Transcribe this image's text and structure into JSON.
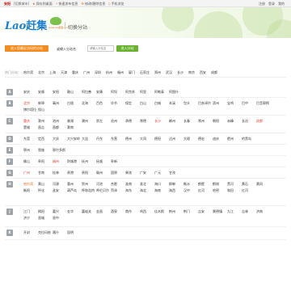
{
  "topbar": {
    "city": "安阳",
    "switch": "[切换城市]",
    "links": [
      {
        "icon": "star-icon",
        "label": "保存到桌面"
      },
      {
        "icon": "lightning-icon",
        "label": "快速发布信息"
      },
      {
        "icon": "gear-icon",
        "label": "修改/删除信息"
      },
      {
        "icon": "phone-icon",
        "label": "手机浏览"
      }
    ],
    "right": [
      "注册",
      "登录",
      "我的"
    ]
  },
  "header": {
    "logo_text": "Lao",
    "logo_cn": "赶集",
    "logo_sub": "www.lao赶集.com",
    "page_title": "切换分站"
  },
  "search": {
    "recent_button": "进入您最近访问的分站",
    "label": "或输入分站名",
    "placeholder": "请输入分站名",
    "button": "进入分站"
  },
  "hot": {
    "label": "热门分站：",
    "cities": [
      "哈尔滨",
      "北京",
      "上海",
      "天津",
      "重庆",
      "广州",
      "深圳",
      "杭州",
      "福州",
      "厦门",
      "石家庄",
      "郑州",
      "武汉",
      "长沙",
      "南京",
      "西安",
      "成都"
    ]
  },
  "letters": [
    {
      "letter": "A",
      "cities": [
        {
          "name": "安庆"
        },
        {
          "name": "安顺"
        },
        {
          "name": "安阳"
        },
        {
          "name": "鞍山"
        },
        {
          "name": "阿拉善"
        },
        {
          "name": "安康"
        },
        {
          "name": "阿坝"
        },
        {
          "name": "阿克苏"
        },
        {
          "name": "阿里"
        },
        {
          "name": "阿勒泰"
        },
        {
          "name": "阿图什"
        }
      ]
    },
    {
      "letter": "B",
      "cities": [
        {
          "name": "北京",
          "s": "hl"
        },
        {
          "name": "蚌埠"
        },
        {
          "name": "亳州"
        },
        {
          "name": "白银"
        },
        {
          "name": "北海"
        },
        {
          "name": "百色"
        },
        {
          "name": "毕节"
        },
        {
          "name": "保定"
        },
        {
          "name": "白山"
        },
        {
          "name": "白城"
        },
        {
          "name": "本溪"
        },
        {
          "name": "包头"
        },
        {
          "name": "巴彦淖尔"
        },
        {
          "name": "滨州"
        },
        {
          "name": "宝鸡"
        },
        {
          "name": "巴中"
        },
        {
          "name": "巴音郭楞"
        },
        {
          "name": "博尔塔拉"
        },
        {
          "name": "保山"
        }
      ]
    },
    {
      "letter": "C",
      "cities": [
        {
          "name": "重庆",
          "s": "hl"
        },
        {
          "name": "滁州"
        },
        {
          "name": "池州"
        },
        {
          "name": "巢湖"
        },
        {
          "name": "潮州"
        },
        {
          "name": "崇左"
        },
        {
          "name": "沧州"
        },
        {
          "name": "承德"
        },
        {
          "name": "常德"
        },
        {
          "name": "长沙",
          "s": "hl"
        },
        {
          "name": "郴州"
        },
        {
          "name": "长春"
        },
        {
          "name": "常州"
        },
        {
          "name": "朝阳"
        },
        {
          "name": "赤峰"
        },
        {
          "name": "长治"
        },
        {
          "name": "成都",
          "s": "hl"
        },
        {
          "name": "楚雄"
        },
        {
          "name": "昌吉"
        },
        {
          "name": "昌都"
        },
        {
          "name": "滁南"
        }
      ]
    },
    {
      "letter": "D",
      "cities": [
        {
          "name": "东莞"
        },
        {
          "name": "定西"
        },
        {
          "name": "大庆"
        },
        {
          "name": "大兴安岭"
        },
        {
          "name": "大连"
        },
        {
          "name": "丹东"
        },
        {
          "name": "东营"
        },
        {
          "name": "德州"
        },
        {
          "name": "大同"
        },
        {
          "name": "德阳"
        },
        {
          "name": "达州"
        },
        {
          "name": "大理"
        },
        {
          "name": "德宏"
        },
        {
          "name": "迪庆"
        },
        {
          "name": "儋州"
        },
        {
          "name": "的黑岛"
        }
      ]
    },
    {
      "letter": "E",
      "cities": [
        {
          "name": "鄂州"
        },
        {
          "name": "恩施"
        },
        {
          "name": "鄂尔多斯"
        }
      ]
    },
    {
      "letter": "F",
      "cities": [
        {
          "name": "佛山"
        },
        {
          "name": "阜阳"
        },
        {
          "name": "福州",
          "s": "hl"
        },
        {
          "name": "防城港"
        },
        {
          "name": "抚州"
        },
        {
          "name": "抚顺"
        },
        {
          "name": "阜新"
        }
      ]
    },
    {
      "letter": "G",
      "cities": [
        {
          "name": "广州",
          "s": "hl"
        },
        {
          "name": "甘南"
        },
        {
          "name": "桂林"
        },
        {
          "name": "贵港"
        },
        {
          "name": "贵阳"
        },
        {
          "name": "赣州"
        },
        {
          "name": "固原"
        },
        {
          "name": "果洛"
        },
        {
          "name": "广安"
        },
        {
          "name": "广元"
        },
        {
          "name": "甘孜"
        }
      ]
    },
    {
      "letter": "H",
      "cities": [
        {
          "name": "哈尔滨",
          "s": "ol"
        },
        {
          "name": "黄山"
        },
        {
          "name": "河源"
        },
        {
          "name": "惠州"
        },
        {
          "name": "贺州"
        },
        {
          "name": "河池"
        },
        {
          "name": "合肥"
        },
        {
          "name": "淮南"
        },
        {
          "name": "淮北"
        },
        {
          "name": "海口"
        },
        {
          "name": "邯郸"
        },
        {
          "name": "衡水"
        },
        {
          "name": "鹤壁"
        },
        {
          "name": "鹤岗"
        },
        {
          "name": "黑河"
        },
        {
          "name": "黄石"
        },
        {
          "name": "黄冈"
        },
        {
          "name": "衡阳"
        },
        {
          "name": "怀化"
        },
        {
          "name": "淮安"
        },
        {
          "name": "葫芦岛"
        },
        {
          "name": "呼和浩特"
        },
        {
          "name": "呼伦贝尔"
        },
        {
          "name": "菏泽"
        },
        {
          "name": "海东"
        },
        {
          "name": "海北"
        },
        {
          "name": "海南"
        },
        {
          "name": "海西"
        },
        {
          "name": "汉中"
        },
        {
          "name": "红河"
        },
        {
          "name": "哈密"
        },
        {
          "name": "和田"
        },
        {
          "name": "红河"
        }
      ]
    },
    {
      "letter": "J",
      "cities": [
        {
          "name": "江门"
        },
        {
          "name": "揭阳"
        },
        {
          "name": "嘉兴"
        },
        {
          "name": "金华"
        },
        {
          "name": "嘉峪关"
        },
        {
          "name": "金昌"
        },
        {
          "name": "酒泉"
        },
        {
          "name": "焦作"
        },
        {
          "name": "鸡西"
        },
        {
          "name": "佳木斯"
        },
        {
          "name": "荆州"
        },
        {
          "name": "荆门"
        },
        {
          "name": "吉安"
        },
        {
          "name": "景德镇"
        },
        {
          "name": "九江"
        },
        {
          "name": "吉林"
        },
        {
          "name": "济南"
        },
        {
          "name": "济宁"
        },
        {
          "name": "晋城"
        },
        {
          "name": "晋中"
        }
      ]
    },
    {
      "letter": "K",
      "cities": [
        {
          "name": "开封"
        },
        {
          "name": "克拉玛依"
        },
        {
          "name": "喀什"
        },
        {
          "name": "昆明"
        }
      ]
    }
  ],
  "colors": {
    "accent_orange": "#f28c1e",
    "accent_green": "#6ab32e",
    "link_red": "#e03c31",
    "logo_blue": "#1a7fcf"
  }
}
